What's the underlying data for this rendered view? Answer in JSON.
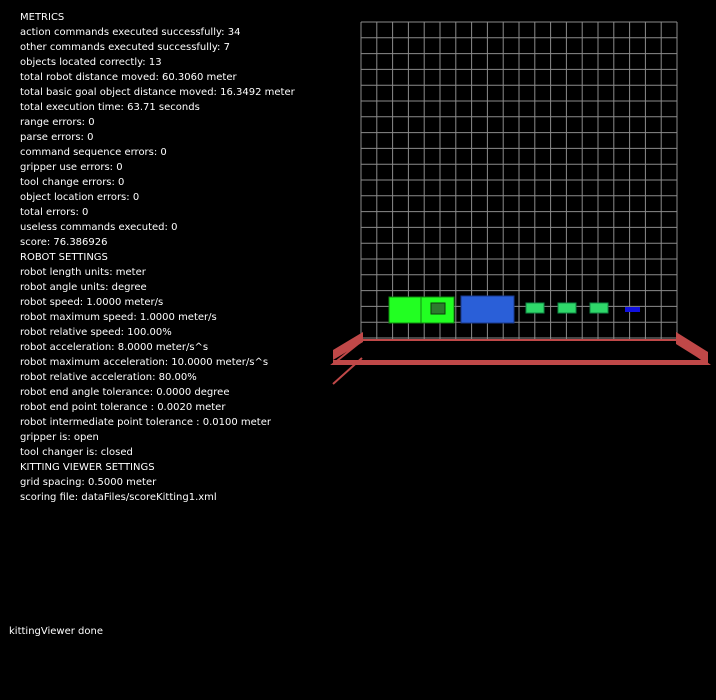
{
  "metrics": {
    "title": "METRICS",
    "lines": [
      "action commands executed successfully: 34",
      "other commands executed successfully: 7",
      "objects located correctly: 13",
      "total robot distance moved: 60.3060 meter",
      "total basic goal object distance moved: 16.3492 meter",
      "total execution time: 63.71 seconds",
      "range errors: 0",
      "parse errors: 0",
      "command sequence errors: 0",
      "gripper use errors: 0",
      "tool change errors: 0",
      "object location errors: 0",
      "total errors: 0",
      "useless commands executed: 0",
      "score: 76.386926"
    ]
  },
  "robot_settings": {
    "title": "ROBOT SETTINGS",
    "lines": [
      "robot length units: meter",
      "robot angle units: degree",
      "robot speed: 1.0000 meter/s",
      "robot maximum speed: 1.0000 meter/s",
      "robot relative speed: 100.00%",
      "robot acceleration: 8.0000 meter/s^s",
      "robot maximum acceleration: 10.0000 meter/s^s",
      "robot relative acceleration: 80.00%",
      "robot end angle tolerance: 0.0000 degree",
      "robot end point tolerance : 0.0020 meter",
      "robot intermediate point tolerance : 0.0100 meter",
      "gripper is: open",
      "tool changer is: closed"
    ]
  },
  "viewer_settings": {
    "title": "KITTING VIEWER SETTINGS",
    "lines": [
      "grid spacing: 0.5000 meter",
      "scoring file: dataFiles/scoreKitting1.xml"
    ]
  },
  "status_text": "kittingViewer done",
  "colors": {
    "background": "#000000",
    "text": "#ffffff",
    "grid": "#8c8c8c",
    "table": "#c04848",
    "green_bright": "#22ff22",
    "kit_blue": "#2a5fd8",
    "part_green": "#2fd86a",
    "part_blue": "#1010e0"
  }
}
